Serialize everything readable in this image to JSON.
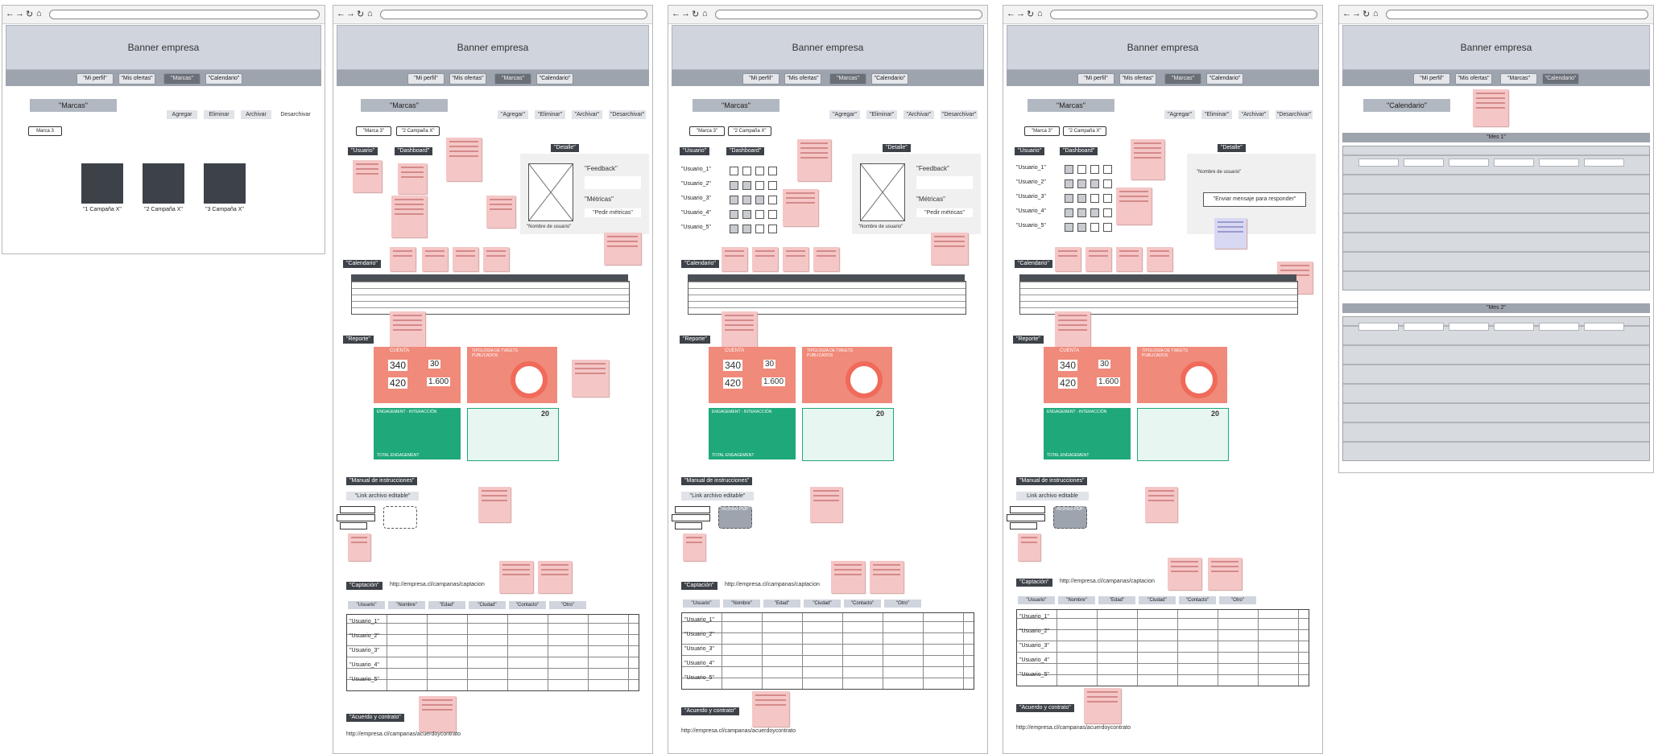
{
  "shared": {
    "banner": "Banner empresa",
    "nav": [
      "\"Mi perfil\"",
      "\"Mis ofertas\"",
      "\"Marcas\"",
      "\"Calendario\""
    ]
  },
  "screen1": {
    "title": "\"Marcas\"",
    "actions": [
      "Agregar",
      "Eliminar",
      "Archivar",
      "Desarchivar"
    ],
    "tag": "Marca 3",
    "campaigns": [
      "\"1 Campaña X\"",
      "\"2 Campaña X\"",
      "\"3 Campaña X\""
    ]
  },
  "screen2": {
    "title": "\"Marcas\"",
    "actions": [
      "\"Agregar\"",
      "\"Eliminar\"",
      "\"Archivar\"",
      "\"Desarchivar\""
    ],
    "breadcrumb": [
      "\"Marca 3\"",
      "\"2 Campaña X\""
    ],
    "sections": {
      "usuario": "\"Usuario\"",
      "dashboard": "\"Dashboard\"",
      "detalle": "\"Detalle\"",
      "calendario": "\"Calendario\"",
      "reporte": "\"Reporte\"",
      "manual": "\"Manual de instrucciones\"",
      "captacion": "\"Captación\"",
      "acuerdo": "\"Acuerdo y contrato\""
    },
    "detail": {
      "feedback": "\"Feedback\"",
      "metricas": "\"Métricas\"",
      "pedir": "\"Pedir métricas\"",
      "user_name": "\"Nombre de usuario\""
    },
    "link_editable": "\"Link archivo editable\"",
    "captacion_url": "http://empresa.cl/campanas/captacion",
    "acuerdo_url": "http://empresa.cl/campanas/acuerdoycontrato",
    "columns": [
      "\"Usuario\"",
      "\"Nombre\"",
      "\"Edad\"",
      "\"Ciudad\"",
      "\"Contacto\"",
      "\"Otro\""
    ],
    "rows": [
      "\"Usuario_1\"",
      "\"Usuario_2\"",
      "\"Usuario_3\"",
      "\"Usuario_4\"",
      "\"Usuario_5\""
    ]
  },
  "screen3": {
    "users": [
      "\"Usuario_1\"",
      "\"Usuario_2\"",
      "\"Usuario_3\"",
      "\"Usuario_4\"",
      "\"Usuario_5\""
    ],
    "detail": {
      "feedback": "\"Feedback\"",
      "metricas": "\"Métricas\"",
      "pedir": "\"Pedir métricas\"",
      "user_name": "\"Nombre de usuario\""
    },
    "link_editable": "\"Link archivo editable\"",
    "ghost": "\"Archivo PDF\"",
    "captacion_url": "http://empresa.cl/campanas/captacion",
    "acuerdo_url": "http://empresa.cl/campanas/acuerdoycontrato"
  },
  "screen4": {
    "users": [
      "\"Usuario_1\"",
      "\"Usuario_2\"",
      "\"Usuario_3\"",
      "\"Usuario_4\"",
      "\"Usuario_5\""
    ],
    "detail": {
      "name": "\"Nombre de usuario\"",
      "send": "\"Enviar mensaje para responder\""
    },
    "link_editable": "Link archivo editable",
    "ghost": "Archivo PDF",
    "captacion_url": "http://empresa.cl/campanas/captacion",
    "acuerdo_url": "http://empresa.cl/campanas/acuerdoycontrato"
  },
  "screen5": {
    "title": "\"Calendario\"",
    "month1": "\"Mes 1\"",
    "month2": "\"Mes 2\""
  },
  "dashboard": {
    "cuenta": "CUENTA",
    "tipologia": "TIPOLOGÍA DE TWEETS PUBLICADOS",
    "seguidores": "340",
    "nuevos": "30",
    "siguiendo": "420",
    "tweets": "1.600",
    "engagement": "ENGAGEMENT - INTERACCIÓN",
    "engagement_pct": "20",
    "total_label": "TOTAL ENGAGEMENT"
  },
  "colors": {
    "banner": "#cfd4dd",
    "nav": "#9ea4ad",
    "sticky": "#f5c6c6",
    "coral": "#f08a7a",
    "green": "#1fa87a",
    "dark": "#3d4148"
  }
}
